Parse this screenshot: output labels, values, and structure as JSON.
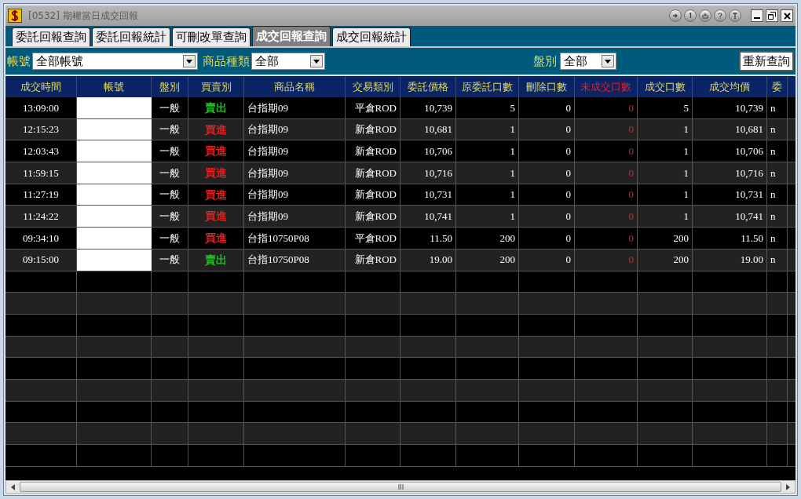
{
  "window": {
    "title": "[0532] 期權當日成交回報"
  },
  "tabs": [
    {
      "label": "委託回報查詢",
      "selected": false
    },
    {
      "label": "委託回報統計",
      "selected": false
    },
    {
      "label": "可刪改單查詢",
      "selected": false
    },
    {
      "label": "成交回報查詢",
      "selected": true
    },
    {
      "label": "成交回報統計",
      "selected": false
    }
  ],
  "filters": {
    "account_label": "帳號",
    "account_value": "全部帳號",
    "product_type_label": "商品種類",
    "product_type_value": "全部",
    "market_label": "盤別",
    "market_value": "全部",
    "requery_button": "重新查詢"
  },
  "table": {
    "columns": [
      {
        "label": "成交時間",
        "kind": "normal"
      },
      {
        "label": "帳號",
        "kind": "normal"
      },
      {
        "label": "盤別",
        "kind": "normal"
      },
      {
        "label": "買賣別",
        "kind": "normal"
      },
      {
        "label": "商品名稱",
        "kind": "normal"
      },
      {
        "label": "交易類別",
        "kind": "normal"
      },
      {
        "label": "委託價格",
        "kind": "normal"
      },
      {
        "label": "原委託口數",
        "kind": "normal"
      },
      {
        "label": "刪除口數",
        "kind": "normal"
      },
      {
        "label": "未成交口數",
        "kind": "alert"
      },
      {
        "label": "成交口數",
        "kind": "normal"
      },
      {
        "label": "成交均價",
        "kind": "normal"
      },
      {
        "label": "委",
        "kind": "normal"
      }
    ],
    "rows": [
      {
        "color": "#20c020",
        "cells": [
          "13:09:00",
          "",
          "一般",
          "賣出",
          "台指期09",
          "平倉ROD",
          "10,739",
          "5",
          "0",
          "0",
          "5",
          "10,739",
          "n"
        ]
      },
      {
        "color": "#e02020",
        "cells": [
          "12:15:23",
          "",
          "一般",
          "買進",
          "台指期09",
          "新倉ROD",
          "10,681",
          "1",
          "0",
          "0",
          "1",
          "10,681",
          "n"
        ]
      },
      {
        "color": "#e02020",
        "cells": [
          "12:03:43",
          "",
          "一般",
          "買進",
          "台指期09",
          "新倉ROD",
          "10,706",
          "1",
          "0",
          "0",
          "1",
          "10,706",
          "n"
        ]
      },
      {
        "color": "#e02020",
        "cells": [
          "11:59:15",
          "",
          "一般",
          "買進",
          "台指期09",
          "新倉ROD",
          "10,716",
          "1",
          "0",
          "0",
          "1",
          "10,716",
          "n"
        ]
      },
      {
        "color": "#e02020",
        "cells": [
          "11:27:19",
          "",
          "一般",
          "買進",
          "台指期09",
          "新倉ROD",
          "10,731",
          "1",
          "0",
          "0",
          "1",
          "10,731",
          "n"
        ]
      },
      {
        "color": "#e02020",
        "cells": [
          "11:24:22",
          "",
          "一般",
          "買進",
          "台指期09",
          "新倉ROD",
          "10,741",
          "1",
          "0",
          "0",
          "1",
          "10,741",
          "n"
        ]
      },
      {
        "color": "#e02020",
        "cells": [
          "09:34:10",
          "",
          "一般",
          "買進",
          "台指10750P08",
          "平倉ROD",
          "11.50",
          "200",
          "0",
          "0",
          "200",
          "11.50",
          "n"
        ]
      },
      {
        "color": "#20c020",
        "cells": [
          "09:15:00",
          "",
          "一般",
          "賣出",
          "台指10750P08",
          "新倉ROD",
          "19.00",
          "200",
          "0",
          "0",
          "200",
          "19.00",
          "n"
        ]
      }
    ]
  }
}
